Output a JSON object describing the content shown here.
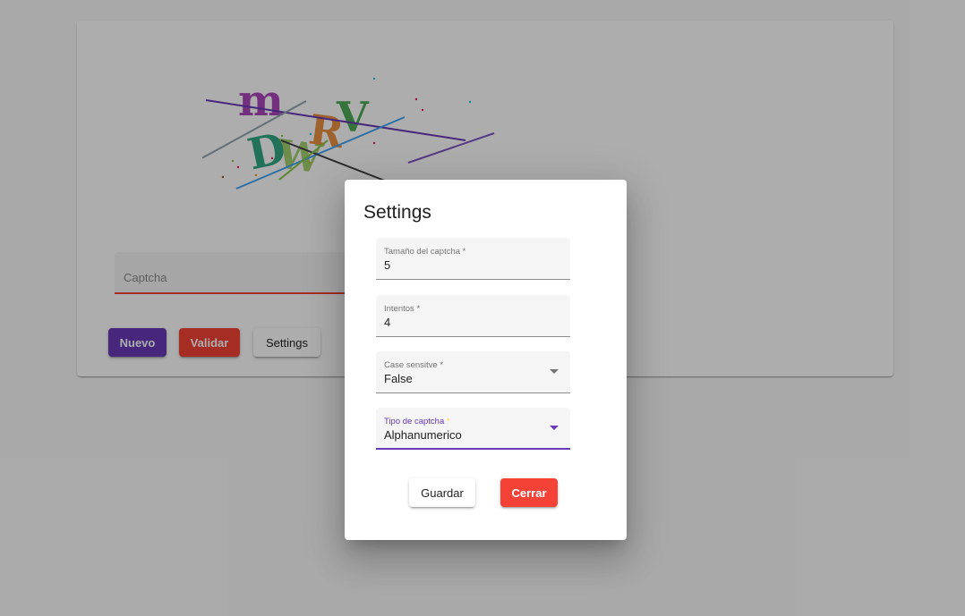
{
  "captcha": {
    "image_text": "mDWRV",
    "field": {
      "placeholder": "Captcha",
      "value": ""
    }
  },
  "actions": {
    "nuevo_label": "Nuevo",
    "validar_label": "Validar",
    "settings_label": "Settings"
  },
  "dialog": {
    "title": "Settings",
    "fields": [
      {
        "label": "Tamaño del captcha",
        "required": "*",
        "value": "5",
        "type": "number"
      },
      {
        "label": "Intentos",
        "required": "*",
        "value": "4",
        "type": "number"
      },
      {
        "label": "Case sensitve",
        "required": "*",
        "value": "False",
        "type": "select",
        "icon": "dropdown-arrow-icon"
      },
      {
        "label": "Tipo de captcha",
        "required": "*",
        "value": "Alphanumerico",
        "type": "select",
        "focused": true,
        "icon": "dropdown-arrow-icon"
      }
    ],
    "guardar_label": "Guardar",
    "cerrar_label": "Cerrar"
  },
  "colors": {
    "primary": "#673ab7",
    "warn": "#f44336",
    "accent": "#ffd740"
  }
}
